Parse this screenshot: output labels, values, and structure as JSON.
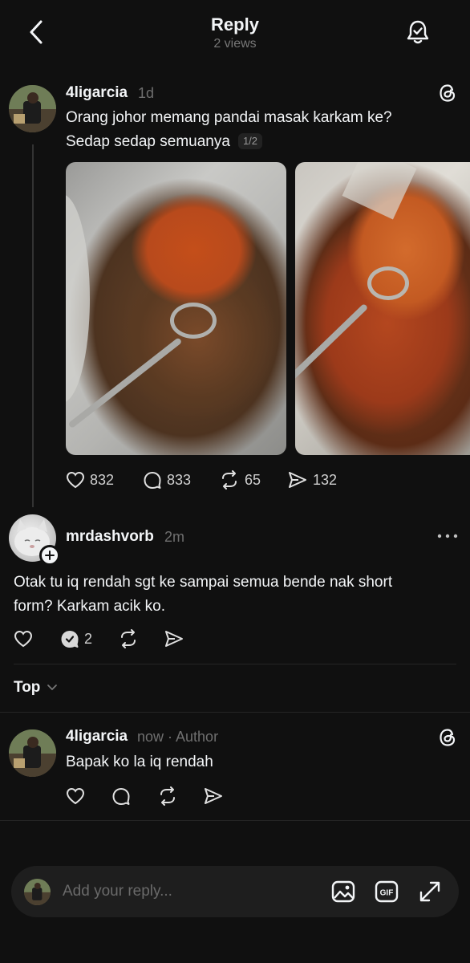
{
  "header": {
    "title": "Reply",
    "subtitle": "2 views"
  },
  "original_post": {
    "username": "4ligarcia",
    "timestamp": "1d",
    "text_line1": "Orang johor memang pandai masak karkam ke?",
    "text_line2": "Sedap sedap semuanya",
    "media_counter": "1/2",
    "likes": "832",
    "comments": "833",
    "reposts": "65",
    "shares": "132"
  },
  "reply_post": {
    "username": "mrdashvorb",
    "timestamp": "2m",
    "text_line1": "Otak tu iq rendah sgt ke sampai semua bende nak short",
    "text_line2": "form? Karkam acik ko.",
    "comments": "2"
  },
  "sort": {
    "label": "Top"
  },
  "author_reply": {
    "username": "4ligarcia",
    "timestamp": "now · Author",
    "text": "Bapak ko la iq rendah"
  },
  "composer": {
    "placeholder": "Add your reply..."
  },
  "colors": {
    "background": "#101010",
    "text": "#f3f5f7",
    "muted": "#777777",
    "divider": "#262626"
  },
  "icons": [
    "back-arrow-icon",
    "bell-check-icon",
    "threads-logo-icon",
    "heart-icon",
    "comment-icon",
    "repost-icon",
    "share-icon",
    "more-icon",
    "plus-icon",
    "chevron-down-icon",
    "image-icon",
    "gif-icon",
    "expand-icon"
  ]
}
